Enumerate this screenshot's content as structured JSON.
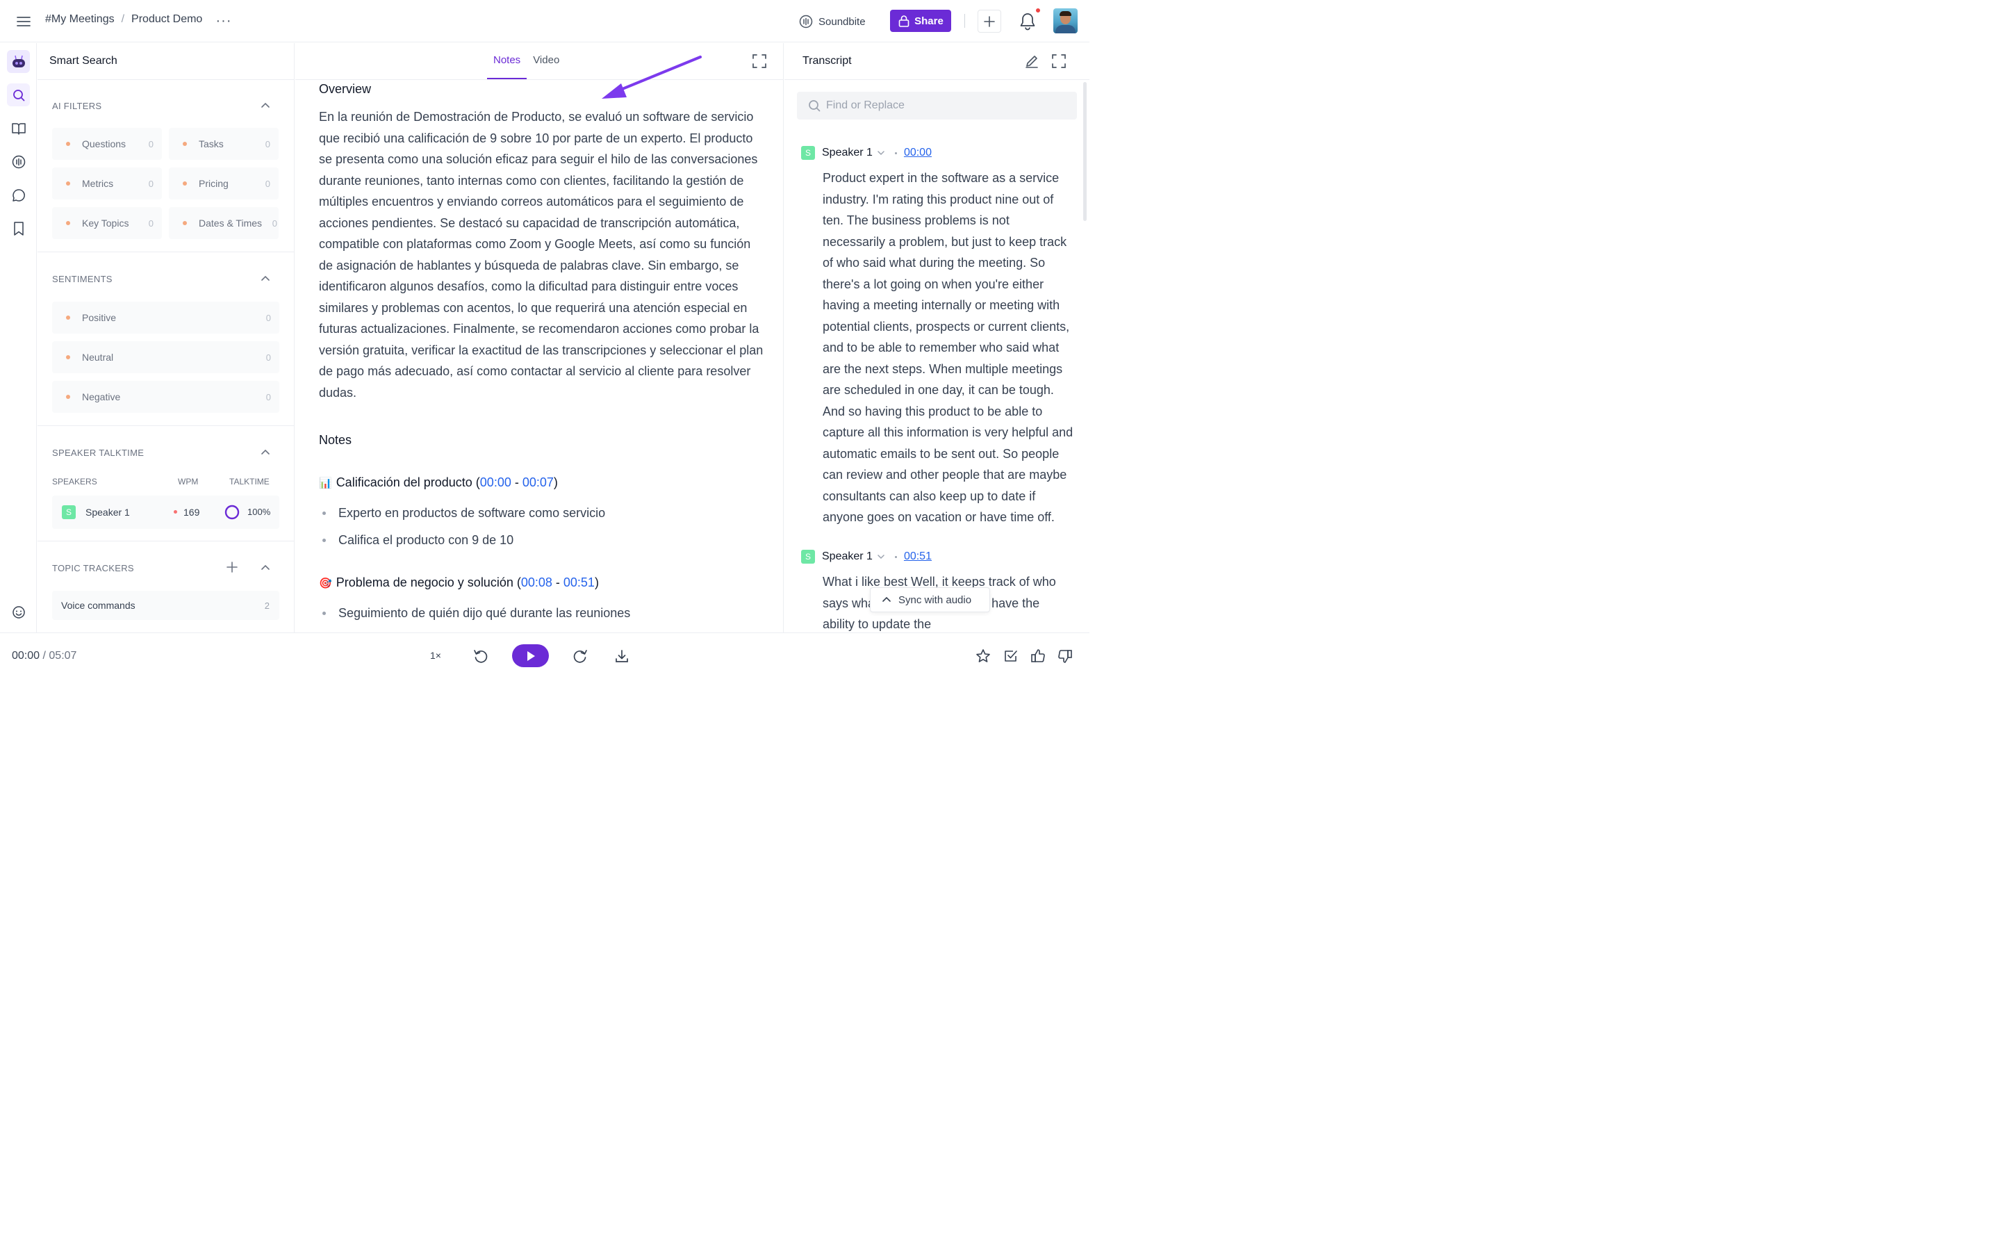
{
  "header": {
    "breadcrumb_root": "#My Meetings",
    "breadcrumb_sep": "/",
    "breadcrumb_current": "Product Demo",
    "more": "···",
    "soundbite_label": "Soundbite",
    "share_label": "Share",
    "accent": "#6b2bd6"
  },
  "rail": {
    "items": [
      "bot-icon",
      "search-icon",
      "book-icon",
      "soundwave-icon",
      "chat-icon",
      "bookmark-icon",
      "smiley-icon"
    ]
  },
  "smart_search": {
    "title": "Smart Search",
    "ai_filters": {
      "title": "AI FILTERS",
      "chips": [
        {
          "label": "Questions",
          "count": "0"
        },
        {
          "label": "Tasks",
          "count": "0"
        },
        {
          "label": "Metrics",
          "count": "0"
        },
        {
          "label": "Pricing",
          "count": "0"
        },
        {
          "label": "Key Topics",
          "count": "0"
        },
        {
          "label": "Dates & Times",
          "count": "0"
        }
      ]
    },
    "sentiments": {
      "title": "SENTIMENTS",
      "chips": [
        {
          "label": "Positive",
          "count": "0"
        },
        {
          "label": "Neutral",
          "count": "0"
        },
        {
          "label": "Negative",
          "count": "0"
        }
      ]
    },
    "talktime": {
      "title": "SPEAKER TALKTIME",
      "col_speakers": "SPEAKERS",
      "col_wpm": "WPM",
      "col_talktime": "TALKTIME",
      "speaker_badge": "S",
      "speaker_name": "Speaker 1",
      "wpm": "169",
      "talktime": "100%"
    },
    "topics": {
      "title": "TOPIC TRACKERS",
      "items": [
        {
          "label": "Voice commands",
          "count": "2"
        }
      ]
    }
  },
  "notes": {
    "tabs": [
      "Notes",
      "Video"
    ],
    "active_tab": "Notes",
    "overview_title": "Overview",
    "overview_text": "En la reunión de Demostración de Producto, se evaluó un software de servicio que recibió una calificación de 9 sobre 10 por parte de un experto. El producto se presenta como una solución eficaz para seguir el hilo de las conversaciones durante reuniones, tanto internas como con clientes, facilitando la gestión de múltiples encuentros y enviando correos automáticos para el seguimiento de acciones pendientes. Se destacó su capacidad de transcripción automática, compatible con plataformas como Zoom y Google Meets, así como su función de asignación de hablantes y búsqueda de palabras clave. Sin embargo, se identificaron algunos desafíos, como la dificultad para distinguir entre voces similares y problemas con acentos, lo que requerirá una atención especial en futuras actualizaciones. Finalmente, se recomendaron acciones como probar la versión gratuita, verificar la exactitud de las transcripciones y seleccionar el plan de pago más adecuado, así como contactar al servicio al cliente para resolver dudas.",
    "notes_title": "Notes",
    "topics": [
      {
        "emoji": "📊",
        "title": "Calificación del producto (",
        "start": "00:00",
        "dash": " - ",
        "end": "00:07",
        "close": ")",
        "bullets": [
          "Experto en productos de software como servicio",
          "Califica el producto con 9 de 10"
        ]
      },
      {
        "emoji": "🎯",
        "title": "Problema de negocio y solución (",
        "start": "00:08",
        "dash": " - ",
        "end": "00:51",
        "close": ")",
        "bullets": [
          "Seguimiento de quién dijo qué durante las reuniones"
        ]
      }
    ]
  },
  "transcript": {
    "title": "Transcript",
    "find_placeholder": "Find or Replace",
    "blocks": [
      {
        "badge": "S",
        "speaker": "Speaker 1",
        "time": "00:00",
        "text": "Product expert in the software as a service industry. I'm rating this product nine out of ten. The business problems is not necessarily a problem, but just to keep track of who said what during the meeting. So there's a lot going on when you're either having a meeting internally or meeting with potential clients, prospects or current clients, and to be able to remember who said what are the next steps. When multiple meetings are scheduled in one day, it can be tough. And so having this product to be able to capture all this information is very helpful and automatic emails to be sent out. So people can review and other people that are maybe consultants can also keep up to date if anyone goes on vacation or have time off."
      },
      {
        "badge": "S",
        "speaker": "Speaker 1",
        "time": "00:51",
        "text": "What i like best Well, it keeps track of who says what as a transcript. You have the ability to update the"
      }
    ],
    "sync_label": "Sync with audio"
  },
  "player": {
    "current": "00:00",
    "sep": " / ",
    "total": "05:07",
    "speed": "1×"
  }
}
